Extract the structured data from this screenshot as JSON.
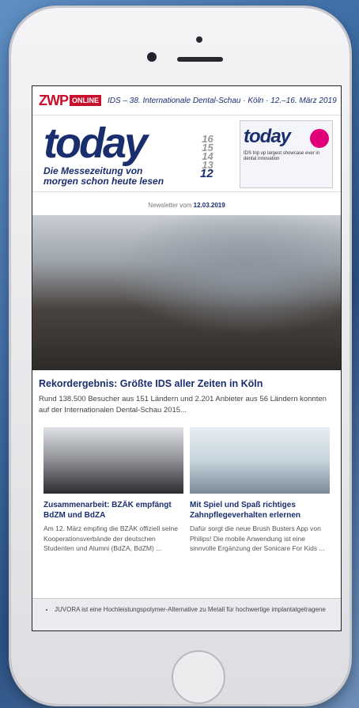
{
  "header": {
    "brand": "ZWP",
    "brand_badge": "ONLINE",
    "event": "IDS – 38. Internationale Dental-Schau · Köln · 12.–16. März 2019"
  },
  "masthead": {
    "title": "today",
    "tagline_1": "Die Messezeitung von",
    "tagline_2": "morgen schon heute lesen",
    "days": [
      "16",
      "15",
      "14",
      "13"
    ],
    "current_day": "12",
    "cover_title": "today",
    "cover_text": "IDS trip up largest showcase ever in dental innovation"
  },
  "newsletter": {
    "prefix": "Newsletter vom",
    "date": "12.03.2019"
  },
  "main_article": {
    "headline": "Rekordergebnis: Größte IDS aller Zeiten in Köln",
    "lead": "Rund 138.500 Besucher aus 151 Ländern und 2.201 Anbieter aus 56 Ländern konnten auf der Internationalen Dental-Schau 2015..."
  },
  "articles": [
    {
      "headline": "Zusammenarbeit: BZÄK empfängt BdZM und BdZA",
      "text": "Am 12. März empfing die BZÄK offiziell seine Kooperationsverbände der deutschen Studenten und Alumni (BdZA, BdZM) ..."
    },
    {
      "headline": "Mit Spiel und Spaß richtiges Zahnpflegeverhalten erlernen",
      "text": "Dafür sorgt die neue Brush Busters App von Philips! Die mobile Anwendung ist eine sinnvolle Ergänzung der Sonicare For Kids ..."
    }
  ],
  "ad": {
    "text": "JUVORA ist eine Hochleistungspolymer-Alternative zu Metall für hochwertige implantatgetragene"
  },
  "colors": {
    "brand_red": "#c8102e",
    "navy": "#1a2e6e"
  }
}
